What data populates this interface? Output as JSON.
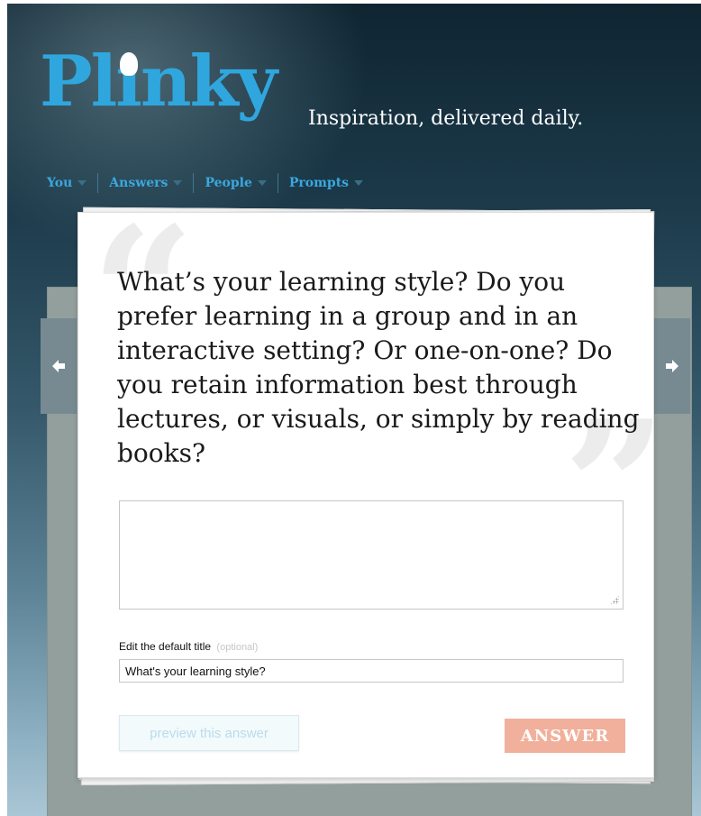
{
  "brand": {
    "logo_text": "Plinky",
    "tagline": "Inspiration, delivered daily."
  },
  "nav": {
    "items": [
      {
        "label": "You"
      },
      {
        "label": "Answers"
      },
      {
        "label": "People"
      },
      {
        "label": "Prompts"
      }
    ]
  },
  "prompt": {
    "text": "What’s your learning style? Do you prefer learning in a group and in an interactive setting? Or one-on-one? Do you retain information best through lectures, or visuals, or simply by reading books?"
  },
  "answer_form": {
    "answer_value": "",
    "title_label": "Edit the default title",
    "title_optional": "(optional)",
    "title_value": "What's your learning style?",
    "preview_label": "preview this answer",
    "submit_label": "ANSWER"
  },
  "colors": {
    "brand_blue": "#2fa7de",
    "answer_button": "#f0b09b"
  },
  "icons": {
    "prev": "arrow-left-icon",
    "next": "arrow-right-icon",
    "nav_caret": "caret-down-icon"
  }
}
